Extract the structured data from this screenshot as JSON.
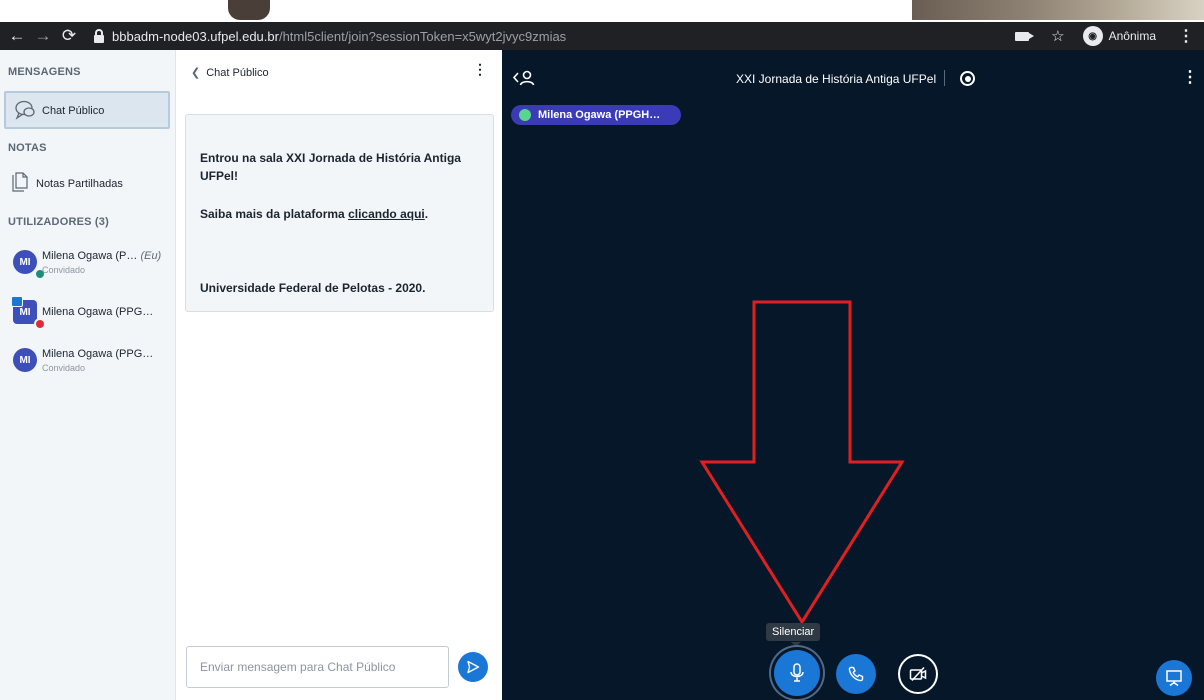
{
  "browser": {
    "url_host": "bbbadm-node03.ufpel.edu.br",
    "url_path": "/html5client/join?sessionToken=x5wyt2jvyc9zmias",
    "incognito_label": "Anônima"
  },
  "sidebar": {
    "messages_title": "MENSAGENS",
    "public_chat_label": "Chat Público",
    "notes_title": "NOTAS",
    "shared_notes_label": "Notas Partilhadas",
    "users_title": "UTILIZADORES (3)",
    "users": [
      {
        "initials": "MI",
        "name": "Milena Ogawa (P…",
        "you_tag": "(Eu)",
        "role": "Convidado"
      },
      {
        "initials": "MI",
        "name": "Milena Ogawa (PPG…",
        "you_tag": "",
        "role": ""
      },
      {
        "initials": "MI",
        "name": "Milena Ogawa (PPG…",
        "you_tag": "",
        "role": "Convidado"
      }
    ]
  },
  "chat": {
    "header": "Chat Público",
    "welcome_line1": "Entrou na sala XXI Jornada de História Antiga UFPel!",
    "welcome_line2_prefix": "Saiba mais da plataforma ",
    "welcome_line2_link": "clicando aqui",
    "welcome_line2_suffix": ".",
    "welcome_line3": "Universidade Federal de Pelotas - 2020.",
    "input_placeholder": "Enviar mensagem para Chat Público"
  },
  "main": {
    "meeting_title": "XXI Jornada de História Antiga UFPel",
    "talker_name": "Milena Ogawa (PPGH…",
    "tooltip": "Silenciar"
  },
  "colors": {
    "accent": "#1b77d6",
    "main_bg": "#06172a",
    "annotation": "#e02020",
    "talker_pill": "#3b3bb8"
  }
}
